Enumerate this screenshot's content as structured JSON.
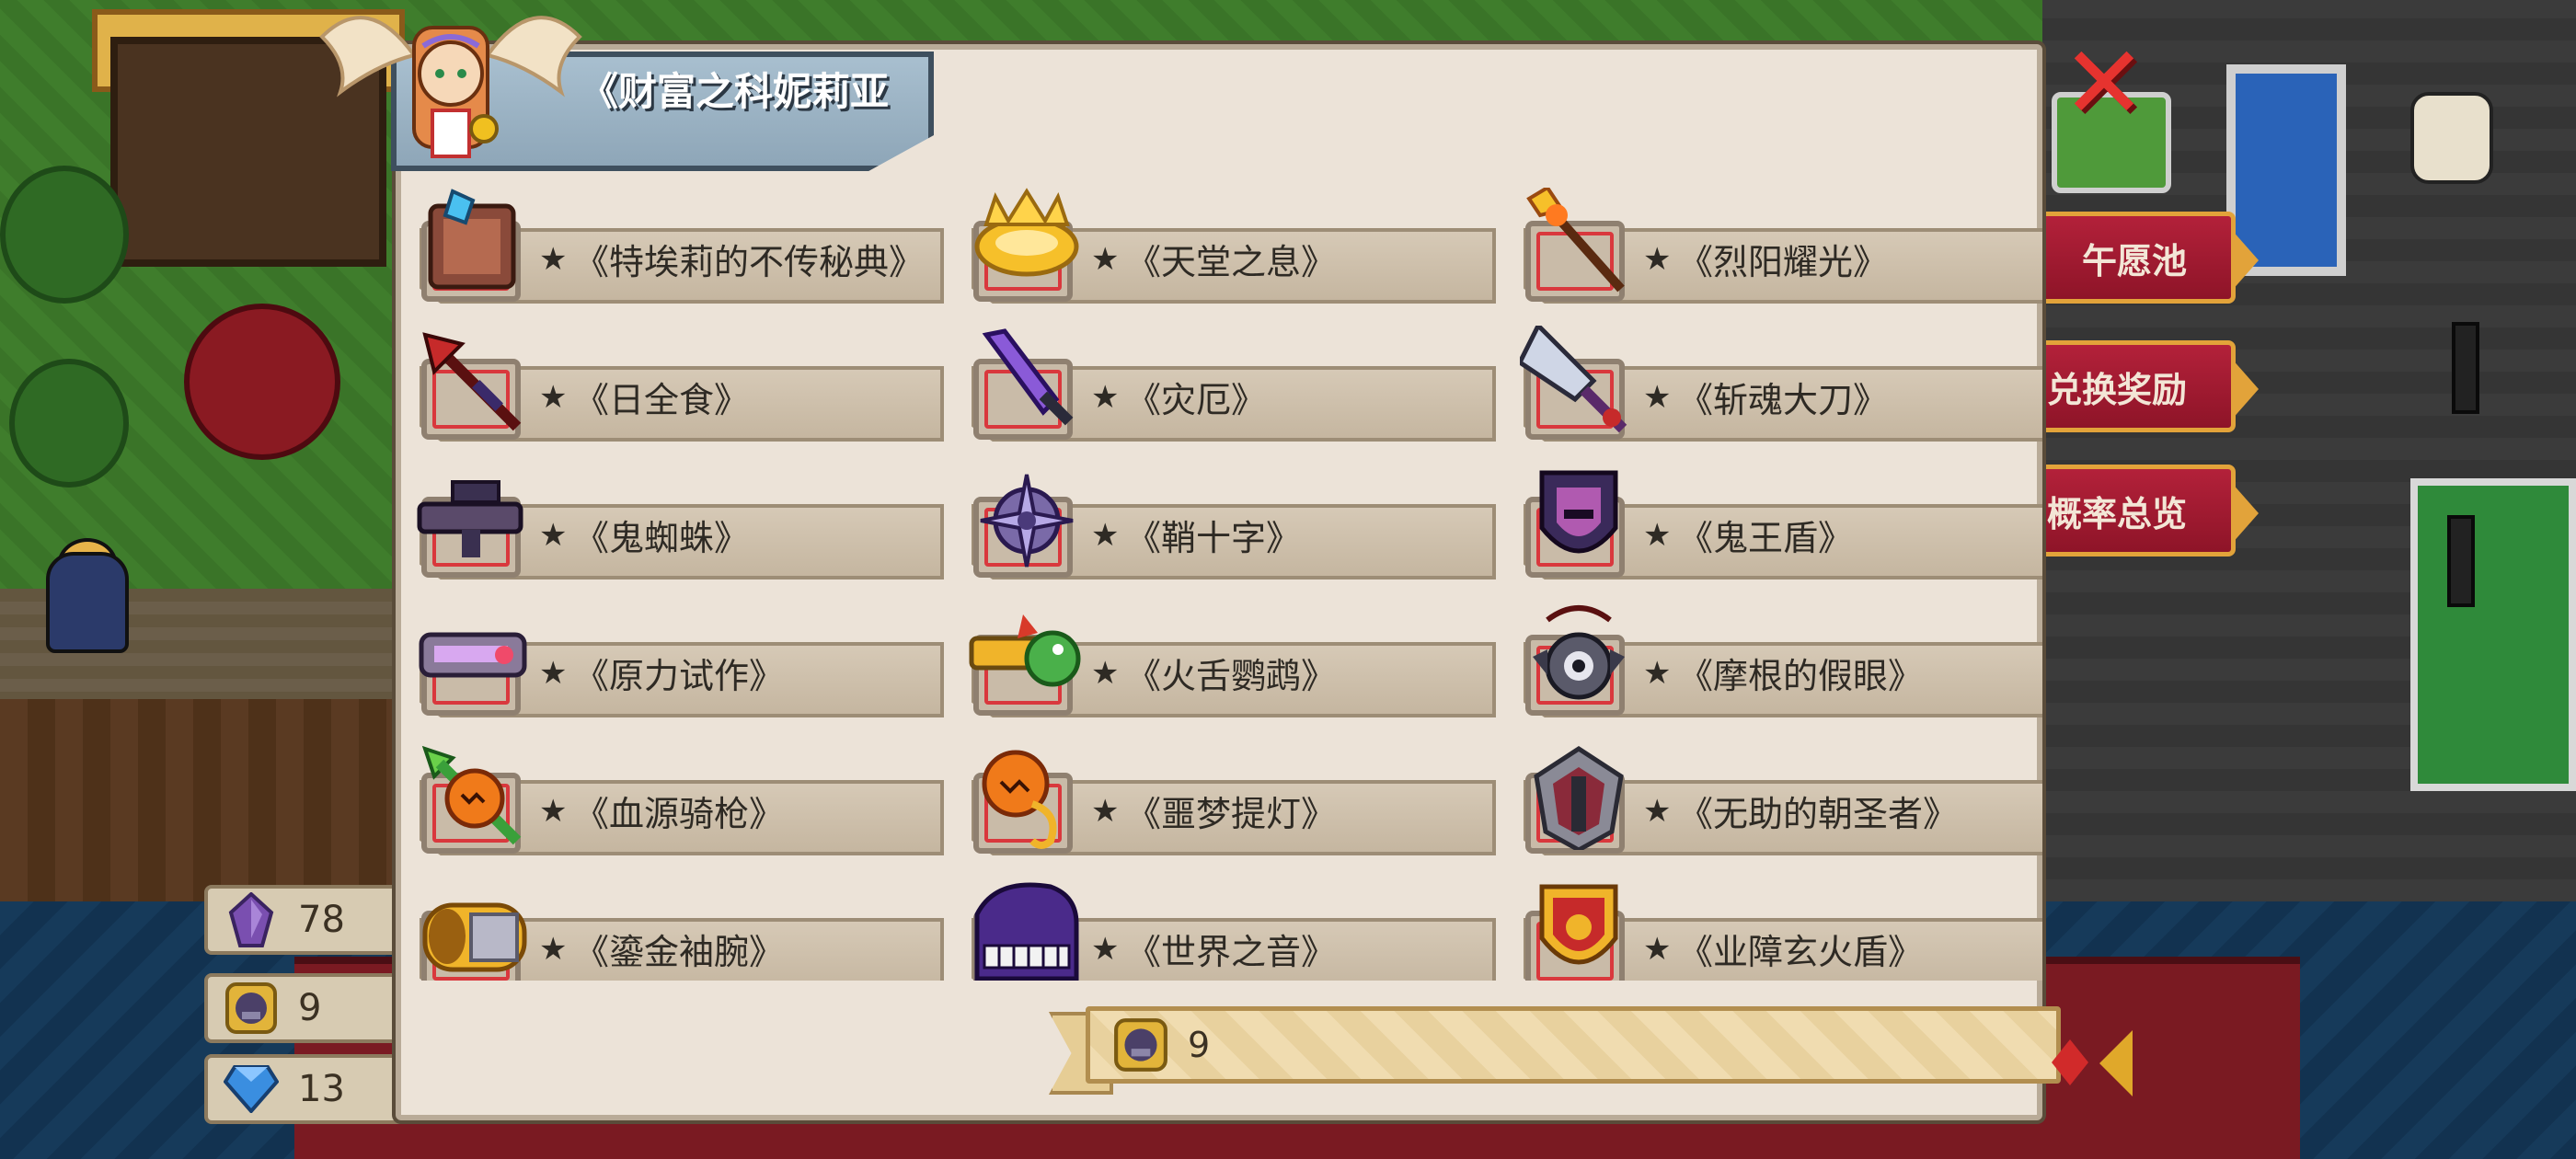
{
  "dialog": {
    "title": "《财富之科妮莉亚",
    "close_label": "✕"
  },
  "items": [
    {
      "name": "《特埃莉的不传秘典》",
      "icon": "spellbook-icon"
    },
    {
      "name": "《天堂之息》",
      "icon": "golden-halo-icon"
    },
    {
      "name": "《烈阳耀光》",
      "icon": "sun-staff-icon"
    },
    {
      "name": "《日全食》",
      "icon": "crimson-trident-icon"
    },
    {
      "name": "《灾厄》",
      "icon": "purple-sword-icon"
    },
    {
      "name": "《斩魂大刀》",
      "icon": "soul-blade-icon"
    },
    {
      "name": "《鬼蜘蛛》",
      "icon": "spider-rifle-icon"
    },
    {
      "name": "《鞘十字》",
      "icon": "cross-shuriken-icon"
    },
    {
      "name": "《鬼王盾》",
      "icon": "demon-shield-icon"
    },
    {
      "name": "《原力试作》",
      "icon": "force-cannon-icon"
    },
    {
      "name": "《火舌鹦鹉》",
      "icon": "parrot-gun-icon"
    },
    {
      "name": "《摩根的假眼》",
      "icon": "false-eye-icon"
    },
    {
      "name": "《血源骑枪》",
      "icon": "pumpkin-lance-icon"
    },
    {
      "name": "《噩梦提灯》",
      "icon": "pumpkin-lantern-icon"
    },
    {
      "name": "《无助的朝圣者》",
      "icon": "pilgrim-armor-icon"
    },
    {
      "name": "《鎏金袖腕》",
      "icon": "golden-bracer-icon"
    },
    {
      "name": "《世界之音》",
      "icon": "piano-icon"
    },
    {
      "name": "《业障玄火盾》",
      "icon": "fire-shield-icon"
    }
  ],
  "item_star": "★",
  "footer": {
    "token_count": "9"
  },
  "currencies": [
    {
      "icon": "purple-crystal-icon",
      "value": "78"
    },
    {
      "icon": "token-coin-icon",
      "value": "9"
    },
    {
      "icon": "blue-gem-icon",
      "value": "13"
    }
  ],
  "side_menu": [
    {
      "label": "午愿池"
    },
    {
      "label": "兑换奖励"
    },
    {
      "label": "概率总览"
    }
  ],
  "colors": {
    "dialog_bg": "#ece3d8",
    "frame_red": "#d9383d",
    "close_red": "#e6332f",
    "side_btn": "#b3213a"
  }
}
